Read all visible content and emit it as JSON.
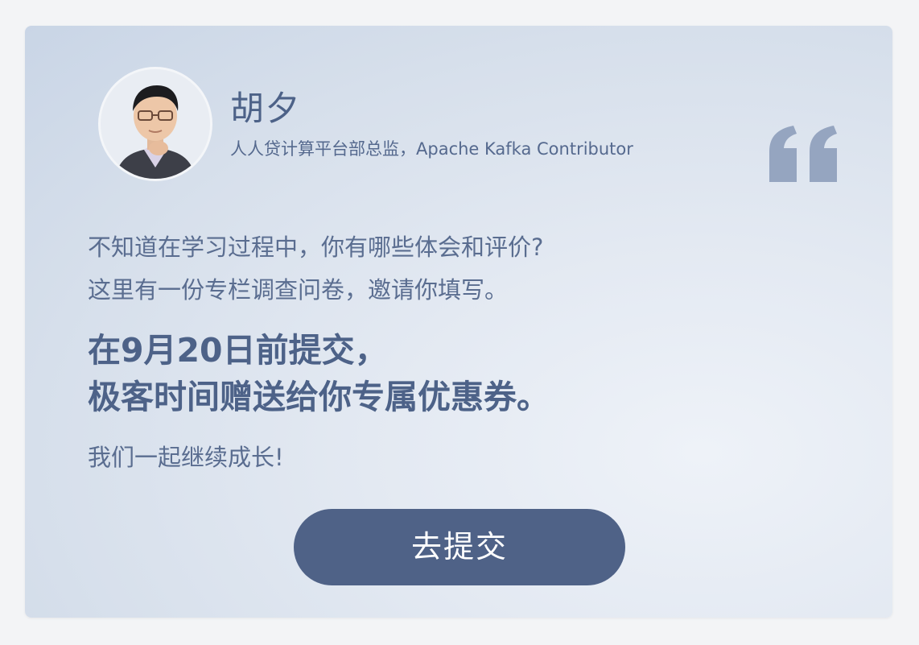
{
  "author": {
    "name": "胡夕",
    "title": "人人贷计算平台部总监，Apache Kafka Contributor"
  },
  "intro": {
    "line1": "不知道在学习过程中，你有哪些体会和评价?",
    "line2": "这里有一份专栏调查问卷，邀请你填写。"
  },
  "highlight": {
    "line1": "在9月20日前提交，",
    "line2": "极客时间赠送给你专属优惠券。"
  },
  "closing": "我们一起继续成长!",
  "button": {
    "label": "去提交"
  },
  "icons": {
    "quote": "quote-icon",
    "avatar": "avatar"
  },
  "colors": {
    "primary": "#4f6287",
    "text": "#5a6d90",
    "quote": "#95a5c0"
  }
}
